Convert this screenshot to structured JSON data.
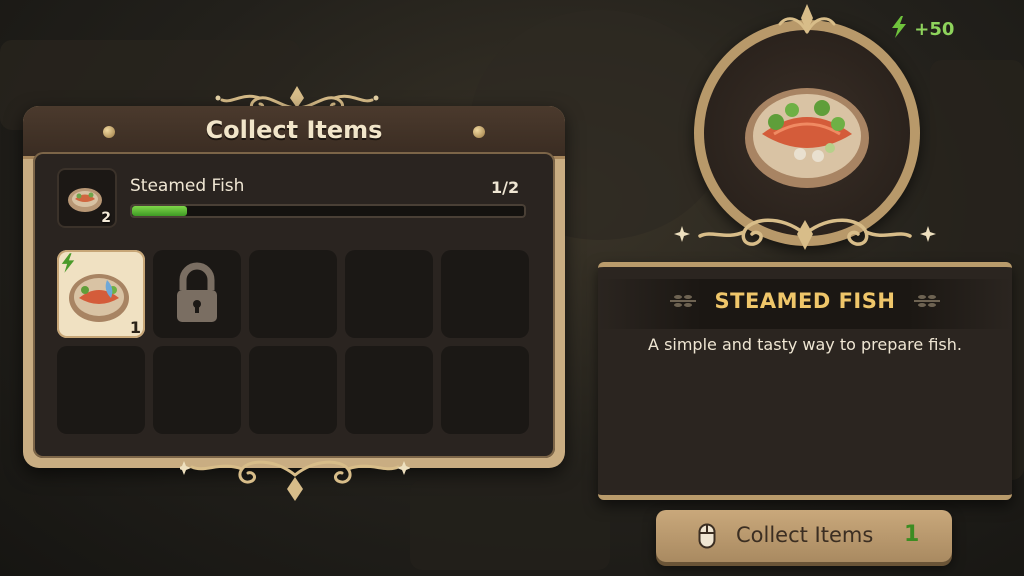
{
  "panel": {
    "title": "Collect Items",
    "quest": {
      "name": "Steamed Fish",
      "icon_count": "2",
      "progress_text": "1/2",
      "progress": 0.14
    },
    "slots": [
      {
        "state": "filled",
        "item": "steamed-fish",
        "count": "1",
        "energy": true
      },
      {
        "state": "locked"
      },
      {
        "state": "empty"
      },
      {
        "state": "empty"
      },
      {
        "state": "empty"
      },
      {
        "state": "empty"
      },
      {
        "state": "empty"
      },
      {
        "state": "empty"
      },
      {
        "state": "empty"
      },
      {
        "state": "empty"
      }
    ]
  },
  "energy": {
    "icon": "lightning-icon",
    "value": "+50",
    "color": "#8ed35c"
  },
  "detail": {
    "title": "STEAMED FISH",
    "description": "A simple and tasty way to prepare fish."
  },
  "collect_button": {
    "label": "Collect Items",
    "count": "1",
    "icon": "mouse-icon"
  },
  "colors": {
    "accent_gold": "#efc66a",
    "frame": "#c9ad82",
    "progress_green": "#5cbf33"
  }
}
